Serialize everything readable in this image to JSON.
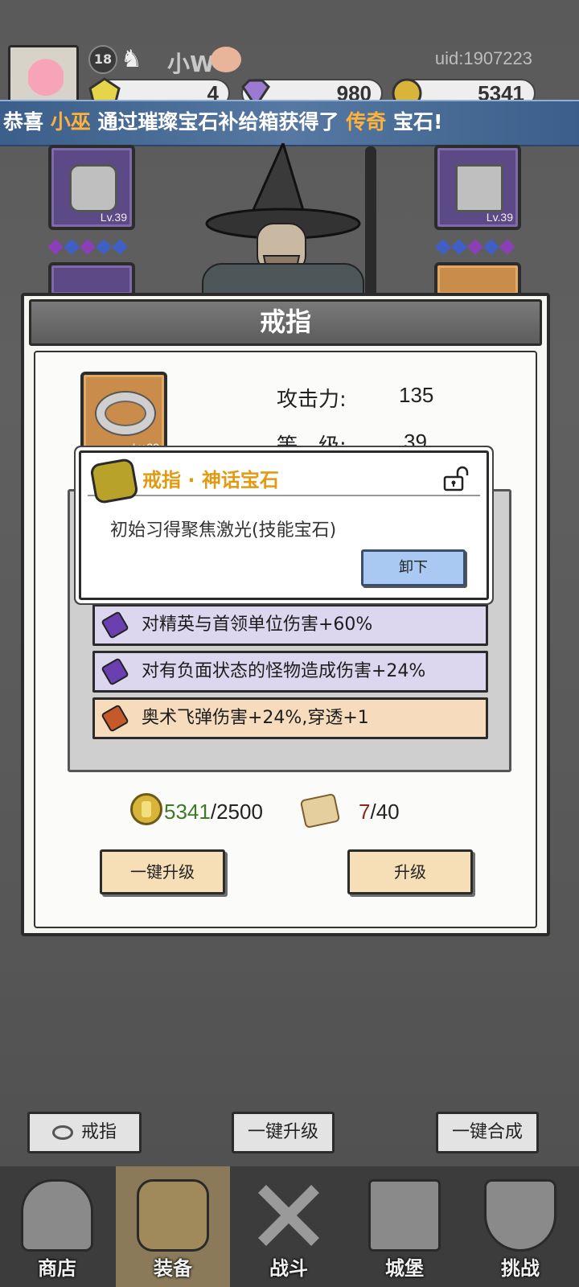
{
  "player": {
    "level": "18",
    "name": "小W",
    "uid": "uid:1907223"
  },
  "resources": [
    {
      "name": "gem-yellow",
      "value": "4",
      "color": "#e6d548"
    },
    {
      "name": "diamond",
      "value": "980",
      "color": "#9b7ad1"
    },
    {
      "name": "gold-coin",
      "value": "5341",
      "color": "#d8b43a"
    }
  ],
  "broadcast": {
    "prefix": "恭喜",
    "player": "小巫",
    "middle": "通过璀璨宝石补给箱获得了",
    "rarity": "传奇",
    "suffix": "宝石!"
  },
  "equipment_slots": {
    "left_top": {
      "level": "Lv.39",
      "icon": "helmet-icon"
    },
    "right_top": {
      "level": "Lv.39",
      "icon": "boots-icon"
    }
  },
  "dialog": {
    "title": "戒指",
    "item_level": "Lv.39",
    "stats": [
      {
        "label": "攻击力:",
        "value": "135"
      },
      {
        "label": "等　级:",
        "value": "39"
      }
    ],
    "affixes": [
      {
        "text": "对精英与首领单位伤害+60%",
        "gem_color": "#6a3fb0",
        "bg": "#ddd6ef"
      },
      {
        "text": "对有负面状态的怪物造成伤害+24%",
        "gem_color": "#6a3fb0",
        "bg": "#ddd6ef"
      },
      {
        "text": "奥术飞弹伤害+24%,穿透+1",
        "gem_color": "#c45a2a",
        "bg": "#f6dcbc"
      }
    ],
    "cost": {
      "gold_have": "5341",
      "gold_need": "/2500",
      "gold_have_color": "#3f7a2a",
      "scroll_have": "7",
      "scroll_need": "/40",
      "scroll_have_color": "#8a2a1e"
    },
    "buttons": {
      "one_click_upgrade": "一键升级",
      "upgrade": "升级"
    }
  },
  "gem_popup": {
    "title": "戒指 · 神话宝石",
    "description": "初始习得聚焦激光(技能宝石)",
    "unequip": "卸下"
  },
  "bottom_actions": {
    "ring": "戒指",
    "one_click_upgrade": "一键升级",
    "one_click_merge": "一键合成"
  },
  "tabs": [
    {
      "label": "商店",
      "icon": "shop-hut-icon",
      "active": false
    },
    {
      "label": "装备",
      "icon": "backpack-icon",
      "active": true
    },
    {
      "label": "战斗",
      "icon": "crossed-swords-icon",
      "active": false
    },
    {
      "label": "城堡",
      "icon": "castle-icon",
      "active": false
    },
    {
      "label": "挑战",
      "icon": "shield-emblem-icon",
      "active": false
    }
  ]
}
